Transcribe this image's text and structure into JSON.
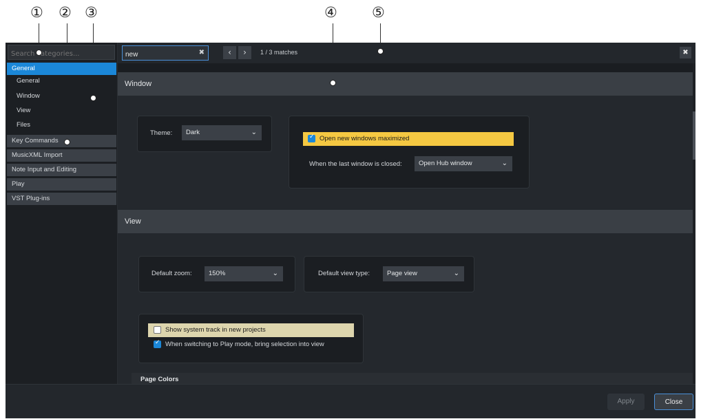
{
  "callouts": [
    "①",
    "②",
    "③",
    "④",
    "⑤"
  ],
  "sidebar": {
    "search_placeholder": "Search categories...",
    "items": [
      {
        "label": "General",
        "kind": "category",
        "selected": true
      },
      {
        "label": "General",
        "kind": "sub"
      },
      {
        "label": "Window",
        "kind": "sub"
      },
      {
        "label": "View",
        "kind": "sub"
      },
      {
        "label": "Files",
        "kind": "sub"
      },
      {
        "label": "Key Commands",
        "kind": "category"
      },
      {
        "label": "MusicXML Import",
        "kind": "category"
      },
      {
        "label": "Note Input and Editing",
        "kind": "category"
      },
      {
        "label": "Play",
        "kind": "category"
      },
      {
        "label": "VST Plug-ins",
        "kind": "category"
      }
    ]
  },
  "topbar": {
    "find_value": "new",
    "clear_icon": "✖",
    "prev_icon": "‹",
    "next_icon": "›",
    "matches": "1 / 3 matches",
    "close_icon": "✖"
  },
  "window_section": {
    "title": "Window",
    "theme_label": "Theme:",
    "theme_value": "Dark",
    "open_maximized_label": "Open new windows maximized",
    "open_maximized_checked": true,
    "last_window_label": "When the last window is closed:",
    "last_window_value": "Open Hub window"
  },
  "view_section": {
    "title": "View",
    "zoom_label": "Default zoom:",
    "zoom_value": "150%",
    "view_type_label": "Default view type:",
    "view_type_value": "Page view",
    "system_track_label": "Show system track in new projects",
    "system_track_checked": false,
    "play_mode_label": "When switching to Play mode, bring selection into view",
    "play_mode_checked": true,
    "page_colors_label": "Page Colors"
  },
  "footer": {
    "apply_label": "Apply",
    "close_label": "Close"
  },
  "colors": {
    "accent": "#1b87d8",
    "highlight_yellow": "#f5c842",
    "highlight_tan": "#ddd5ad"
  }
}
